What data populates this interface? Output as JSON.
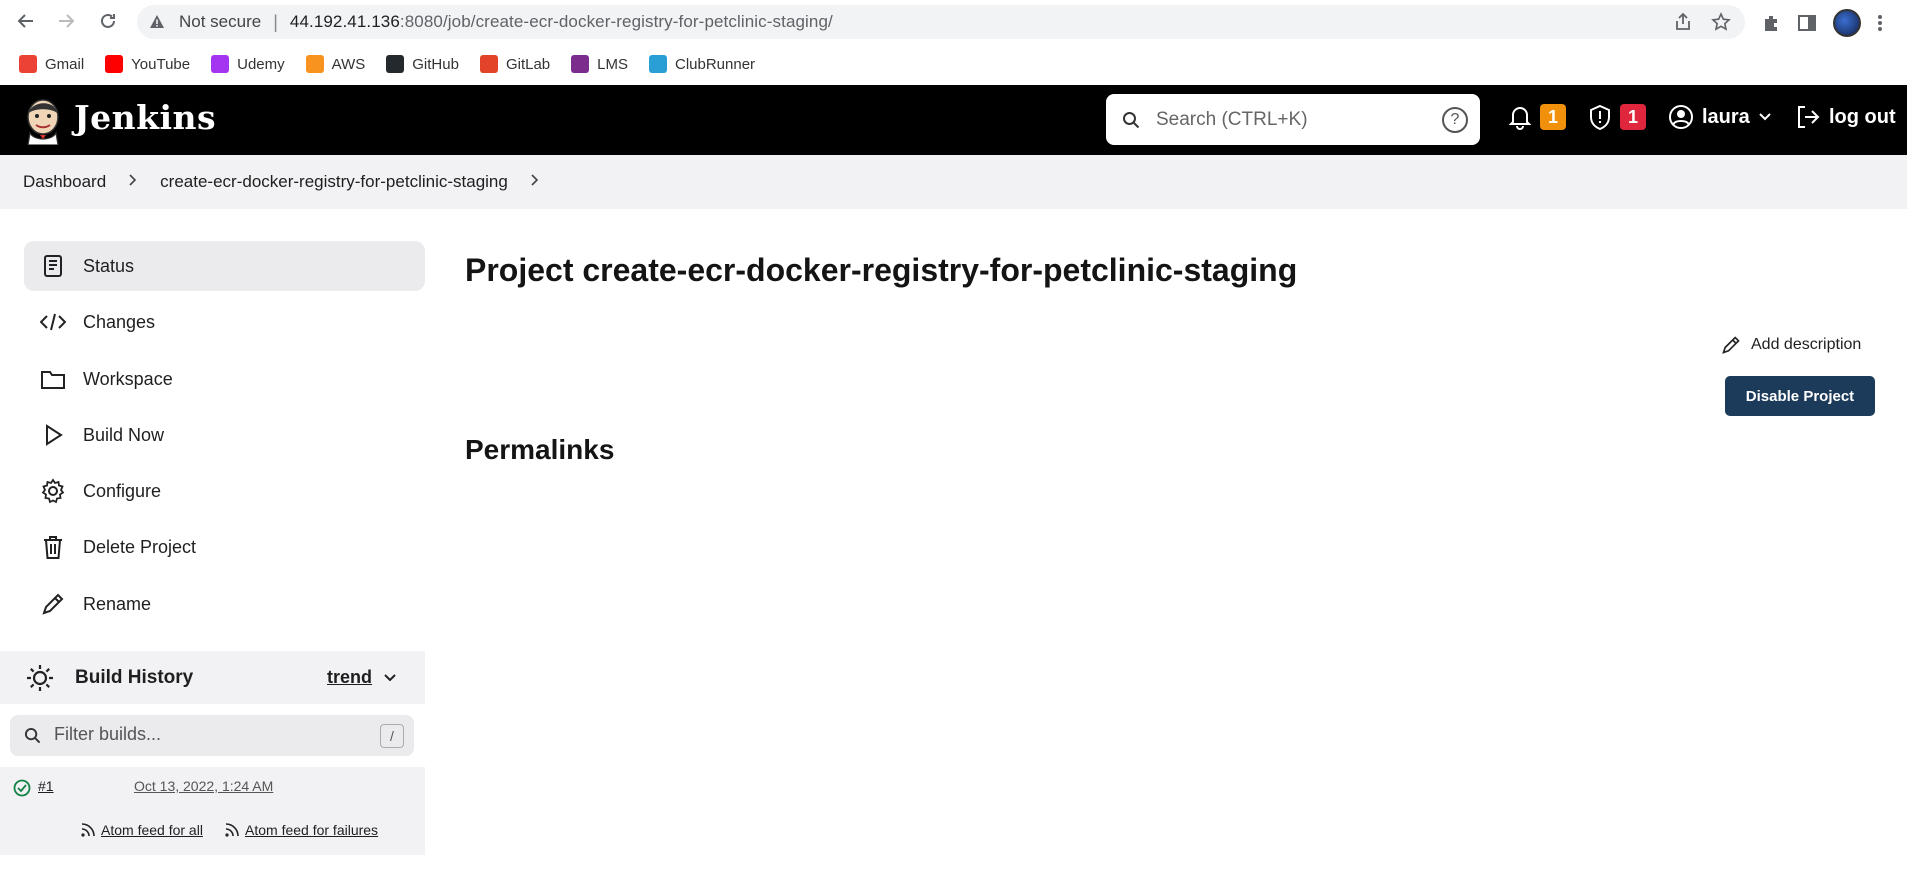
{
  "browser": {
    "security_text": "Not secure",
    "url_host": "44.192.41.136",
    "url_rest": ":8080/job/create-ecr-docker-registry-for-petclinic-staging/",
    "bookmarks": [
      {
        "label": "Gmail",
        "icon": "gmail-icon",
        "color": "#ea4335"
      },
      {
        "label": "YouTube",
        "icon": "youtube-icon",
        "color": "#ff0000"
      },
      {
        "label": "Udemy",
        "icon": "udemy-icon",
        "color": "#a435f0"
      },
      {
        "label": "AWS",
        "icon": "aws-icon",
        "color": "#f7931e"
      },
      {
        "label": "GitHub",
        "icon": "github-icon",
        "color": "#24292e"
      },
      {
        "label": "GitLab",
        "icon": "gitlab-icon",
        "color": "#e24329"
      },
      {
        "label": "LMS",
        "icon": "lms-icon",
        "color": "#7b2d8e"
      },
      {
        "label": "ClubRunner",
        "icon": "clubrunner-icon",
        "color": "#2a9fd6"
      }
    ]
  },
  "header": {
    "brand": "Jenkins",
    "search_placeholder": "Search (CTRL+K)",
    "notifications_count": "1",
    "notifications_color": "#f0900b",
    "security_count": "1",
    "security_color": "#e0263d",
    "user": "laura",
    "logout": "log out"
  },
  "breadcrumb": {
    "items": [
      "Dashboard",
      "create-ecr-docker-registry-for-petclinic-staging"
    ]
  },
  "sidebar": {
    "tasks": [
      {
        "label": "Status",
        "icon": "status-icon"
      },
      {
        "label": "Changes",
        "icon": "code-icon"
      },
      {
        "label": "Workspace",
        "icon": "folder-icon"
      },
      {
        "label": "Build Now",
        "icon": "play-icon"
      },
      {
        "label": "Configure",
        "icon": "gear-icon"
      },
      {
        "label": "Delete Project",
        "icon": "trash-icon"
      },
      {
        "label": "Rename",
        "icon": "pencil-icon"
      }
    ],
    "build_history": {
      "title": "Build History",
      "trend": "trend",
      "filter_placeholder": "Filter builds...",
      "filter_key": "/",
      "builds": [
        {
          "number": "#1",
          "date": "Oct 13, 2022, 1:24 AM",
          "status": "success"
        }
      ],
      "feed_all": "Atom feed for all",
      "feed_failures": "Atom feed for failures"
    }
  },
  "main": {
    "title": "Project create-ecr-docker-registry-for-petclinic-staging",
    "add_description": "Add description",
    "disable_button": "Disable Project",
    "permalinks": "Permalinks"
  }
}
